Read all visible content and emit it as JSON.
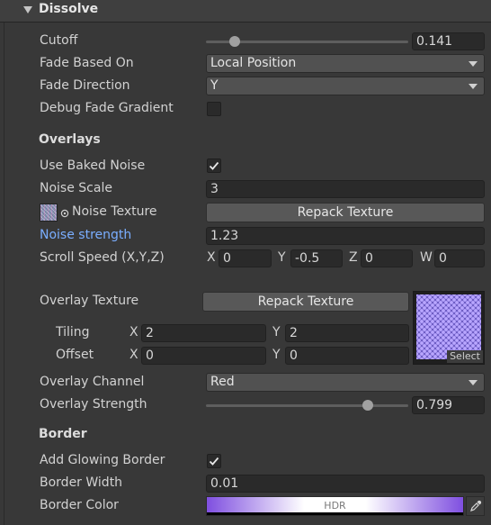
{
  "section": {
    "title": "Dissolve"
  },
  "cutoff": {
    "label": "Cutoff",
    "value": "0.141",
    "fraction": 0.141
  },
  "fade_based_on": {
    "label": "Fade Based On",
    "value": "Local Position"
  },
  "fade_direction": {
    "label": "Fade Direction",
    "value": "Y"
  },
  "debug_fade_gradient": {
    "label": "Debug Fade Gradient",
    "checked": false
  },
  "overlays": {
    "header": "Overlays",
    "use_baked_noise": {
      "label": "Use Baked Noise",
      "checked": true
    },
    "noise_scale": {
      "label": "Noise Scale",
      "value": "3"
    },
    "noise_texture": {
      "label": "Noise Texture",
      "button": "Repack Texture"
    },
    "noise_strength": {
      "label": "Noise strength",
      "value": "1.23",
      "label_color": "#7aaeff"
    },
    "scroll_speed": {
      "label": "Scroll Speed (X,Y,Z)",
      "x_label": "X",
      "x": "0",
      "y_label": "Y",
      "y": "-0.5",
      "z_label": "Z",
      "z": "0",
      "w_label": "W",
      "w": "0"
    },
    "overlay_texture": {
      "label": "Overlay Texture",
      "button": "Repack Texture",
      "select_label": "Select"
    },
    "tiling": {
      "label": "Tiling",
      "x_label": "X",
      "x": "2",
      "y_label": "Y",
      "y": "2"
    },
    "offset": {
      "label": "Offset",
      "x_label": "X",
      "x": "0",
      "y_label": "Y",
      "y": "0"
    },
    "overlay_channel": {
      "label": "Overlay Channel",
      "value": "Red"
    },
    "overlay_strength": {
      "label": "Overlay Strength",
      "value": "0.799",
      "fraction": 0.799
    }
  },
  "border": {
    "header": "Border",
    "add_glowing_border": {
      "label": "Add Glowing Border",
      "checked": true
    },
    "border_width": {
      "label": "Border Width",
      "value": "0.01"
    },
    "border_color": {
      "label": "Border Color",
      "badge": "HDR",
      "gradient_from": "#7f4fe0",
      "gradient_to": "#ffffff"
    }
  },
  "icons": {
    "collapse": "triangle-down-icon",
    "dropdown": "chevron-down-icon",
    "check": "checkmark-icon",
    "eyedropper": "eyedropper-icon",
    "texture_preview": "noise-texture-thumbnail",
    "object_picker": "object-picker-icon"
  },
  "colors": {
    "background": "#383838",
    "field": "#2a2a2a",
    "button": "#585858",
    "accent_label": "#7aaeff",
    "texture_purple": "#8f78e0"
  }
}
